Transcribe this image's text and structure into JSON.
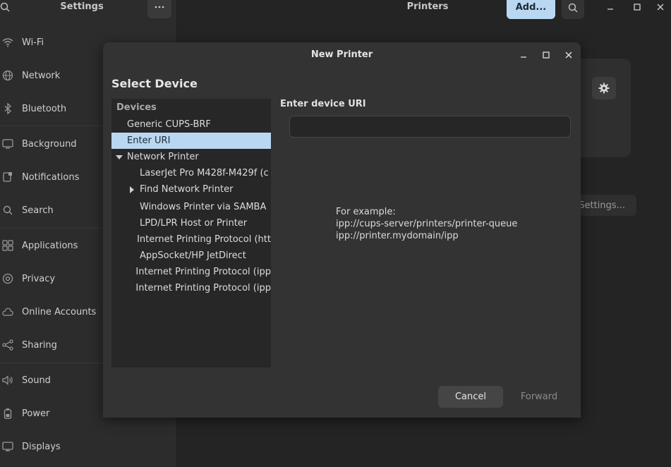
{
  "sidebar": {
    "title": "Settings",
    "items": [
      {
        "label": "Wi-Fi",
        "icon": "wifi-icon"
      },
      {
        "label": "Network",
        "icon": "network-icon"
      },
      {
        "label": "Bluetooth",
        "icon": "bluetooth-icon"
      },
      {
        "label": "Background",
        "icon": "background-icon"
      },
      {
        "label": "Notifications",
        "icon": "notifications-icon"
      },
      {
        "label": "Search",
        "icon": "search-icon"
      },
      {
        "label": "Applications",
        "icon": "applications-icon"
      },
      {
        "label": "Privacy",
        "icon": "privacy-icon"
      },
      {
        "label": "Online Accounts",
        "icon": "cloud-icon"
      },
      {
        "label": "Sharing",
        "icon": "share-icon"
      },
      {
        "label": "Sound",
        "icon": "speaker-icon"
      },
      {
        "label": "Power",
        "icon": "battery-icon"
      },
      {
        "label": "Displays",
        "icon": "display-icon"
      }
    ]
  },
  "printers": {
    "title": "Printers",
    "add_label": "Add...",
    "settings_label": "Settings..."
  },
  "dialog": {
    "title": "New Printer",
    "heading": "Select Device",
    "devices_header": "Devices",
    "devices": [
      {
        "label": "Generic CUPS-BRF",
        "selected": false
      },
      {
        "label": "Enter URI",
        "selected": true
      },
      {
        "label": "Network Printer",
        "expanded": true
      },
      {
        "label": "LaserJet Pro M428f-M429f (c"
      },
      {
        "label": "Find Network Printer",
        "expandable": true
      },
      {
        "label": "Windows Printer via SAMBA"
      },
      {
        "label": "LPD/LPR Host or Printer"
      },
      {
        "label": "Internet Printing Protocol (htt"
      },
      {
        "label": "AppSocket/HP JetDirect"
      },
      {
        "label": "Internet Printing Protocol (ipp"
      },
      {
        "label": "Internet Printing Protocol (ipp"
      }
    ],
    "uri_label": "Enter device URI",
    "uri_value": "",
    "example_lines": [
      "For example:",
      "ipp://cups-server/printers/printer-queue",
      "ipp://printer.mydomain/ipp"
    ],
    "cancel_label": "Cancel",
    "forward_label": "Forward"
  },
  "colors": {
    "accent": "#b9d7f1",
    "background": "#242424",
    "dialog": "#333333"
  }
}
